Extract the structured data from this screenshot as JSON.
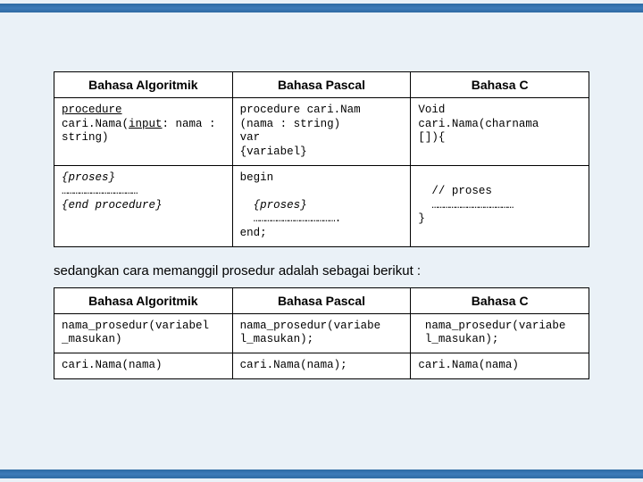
{
  "table1": {
    "headers": [
      "Bahasa Algoritmik",
      "Bahasa Pascal",
      "Bahasa C"
    ],
    "row1": {
      "algo_l1": "procedure",
      "algo_l2a": "cari.Nama(",
      "algo_l2u": "input",
      "algo_l2b": ": nama :",
      "algo_l3": "string)",
      "pascal_l1": "procedure cari.Nam",
      "pascal_l2": "(nama : string)",
      "pascal_l3": "var",
      "pascal_l4": "{variabel}",
      "c_l1": "Void",
      "c_l2": "cari.Nama(charnama",
      "c_l3": "[]){"
    },
    "row2": {
      "algo_l1": "{proses}",
      "algo_dots": "…………………………………",
      "algo_l3": "{end procedure}",
      "pascal_begin": "begin",
      "pascal_l1": "{proses}",
      "pascal_dots": "…………………………………….",
      "pascal_l3": "end;",
      "c_l1": "// proses",
      "c_dots": "……………………………………",
      "c_l3": "}"
    }
  },
  "intertext": "sedangkan cara memanggil prosedur adalah sebagai berikut :",
  "table2": {
    "headers": [
      "Bahasa Algoritmik",
      "Bahasa Pascal",
      "Bahasa C"
    ],
    "row1": {
      "algo_l1": "nama_prosedur(variabel",
      "algo_l2": "_masukan)",
      "pascal_l1": "nama_prosedur(variabe",
      "pascal_l2": "l_masukan);",
      "c_l1": "nama_prosedur(variabe",
      "c_l2": "l_masukan);"
    },
    "row2": {
      "algo": "cari.Nama(nama)",
      "pascal": "cari.Nama(nama);",
      "c": "cari.Nama(nama)"
    }
  }
}
